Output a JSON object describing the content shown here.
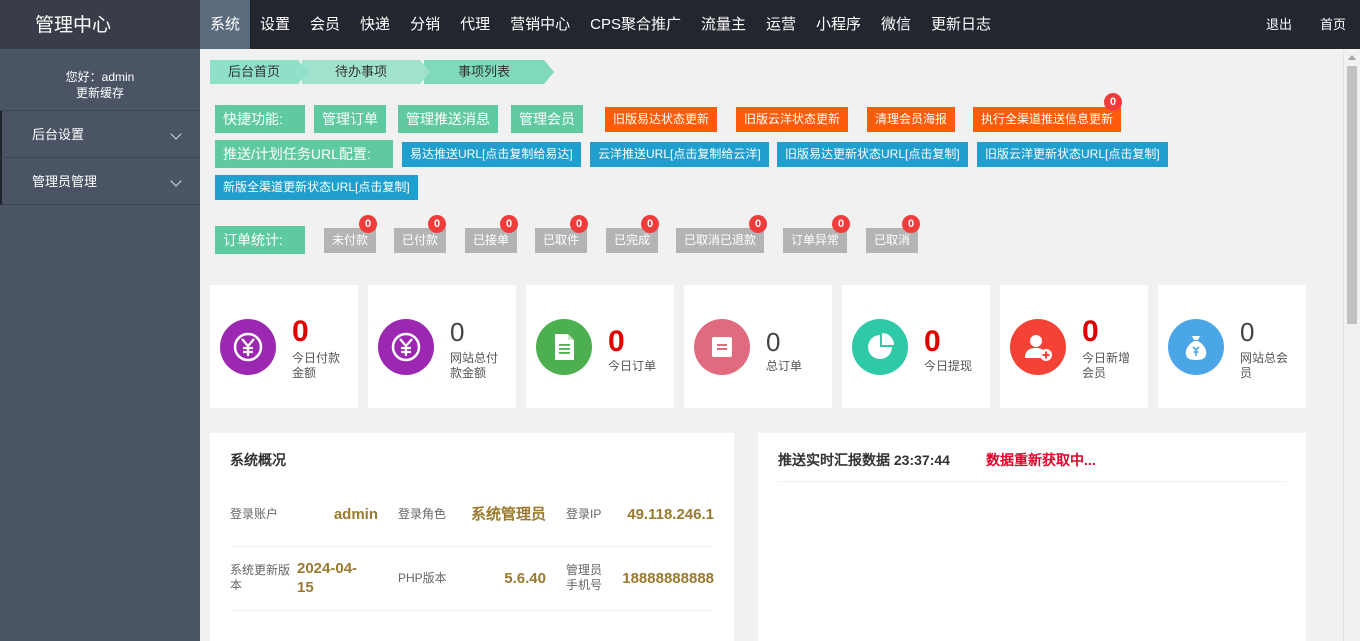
{
  "brand": "管理中心",
  "nav": [
    "系统",
    "设置",
    "会员",
    "快递",
    "分销",
    "代理",
    "营销中心",
    "CPS聚合推广",
    "流量主",
    "运营",
    "小程序",
    "微信",
    "更新日志"
  ],
  "nav_right": [
    "退出",
    "首页"
  ],
  "sidebar": {
    "greeting": "您好：admin",
    "refresh": "更新缓存",
    "items": [
      "后台设置",
      "管理员管理"
    ]
  },
  "breadcrumb": [
    "后台首页",
    "待办事项",
    "事项列表"
  ],
  "quick": {
    "label": "快捷功能:",
    "buttons": [
      "管理订单",
      "管理推送消息",
      "管理会员"
    ],
    "orange": [
      "旧版易达状态更新",
      "旧版云洋状态更新",
      "清理会员海报",
      "执行全渠道推送信息更新"
    ],
    "orange_badge": "0"
  },
  "push": {
    "label": "推送/计划任务URL配置:",
    "buttons": [
      "易达推送URL[点击复制给易达]",
      "云洋推送URL[点击复制给云洋]",
      "旧版易达更新状态URL[点击复制]",
      "旧版云洋更新状态URL[点击复制]",
      "新版全渠道更新状态URL[点击复制]"
    ]
  },
  "orders": {
    "label": "订单统计:",
    "items": [
      {
        "name": "未付款",
        "count": "0"
      },
      {
        "name": "已付款",
        "count": "0"
      },
      {
        "name": "已接单",
        "count": "0"
      },
      {
        "name": "已取件",
        "count": "0"
      },
      {
        "name": "已完成",
        "count": "0"
      },
      {
        "name": "已取消已退款",
        "count": "0"
      },
      {
        "name": "订单异常",
        "count": "0"
      },
      {
        "name": "已取消",
        "count": "0"
      }
    ]
  },
  "stats": [
    {
      "value": "0",
      "label": "今日付款金额",
      "color": "#9c27b0",
      "icon": "yen-icon"
    },
    {
      "value": "0",
      "label": "网站总付款金额",
      "color": "#9c27b0",
      "icon": "yen-icon"
    },
    {
      "value": "0",
      "label": "今日订单",
      "color": "#4caf50",
      "icon": "document-icon"
    },
    {
      "value": "0",
      "label": "总订单",
      "color": "#e06b7e",
      "icon": "note-icon"
    },
    {
      "value": "0",
      "label": "今日提现",
      "color": "#2ec9a6",
      "icon": "pie-icon"
    },
    {
      "value": "0",
      "label": "今日新增会员",
      "color": "#f44336",
      "icon": "user-add-icon"
    },
    {
      "value": "0",
      "label": "网站总会员",
      "color": "#4ba6e8",
      "icon": "money-bag-icon"
    }
  ],
  "overview": {
    "title": "系统概况",
    "rows": [
      [
        {
          "k": "登录账户",
          "v": "admin"
        },
        {
          "k": "登录角色",
          "v": "系统管理员"
        },
        {
          "k": "登录IP",
          "v": "49.118.246.1"
        }
      ],
      [
        {
          "k": "系统更新版本",
          "v": "2024-04-15"
        },
        {
          "k": "PHP版本",
          "v": "5.6.40"
        },
        {
          "k": "管理员手机号",
          "v": "18888888888"
        }
      ]
    ]
  },
  "realtime": {
    "title": "推送实时汇报数据 23:37:44",
    "status": "数据重新获取中..."
  }
}
